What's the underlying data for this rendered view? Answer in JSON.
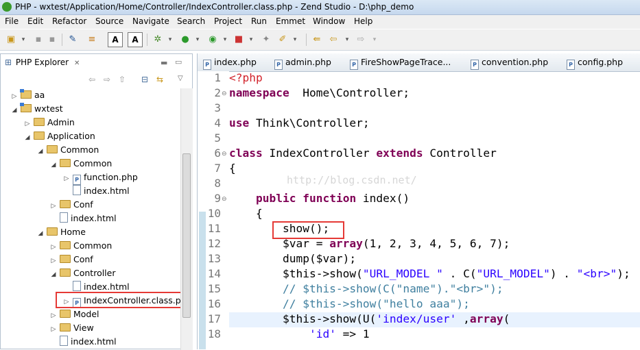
{
  "window": {
    "title": "PHP - wxtest/Application/Home/Controller/IndexController.class.php - Zend Studio - D:\\php_demo"
  },
  "menu": [
    "File",
    "Edit",
    "Refactor",
    "Source",
    "Navigate",
    "Search",
    "Project",
    "Run",
    "Emmet",
    "Window",
    "Help"
  ],
  "explorer": {
    "tab_label": "PHP Explorer",
    "tab_close": "✕",
    "tree": [
      {
        "label": "aa",
        "depth": 0,
        "twisty": "▷",
        "icon": "project"
      },
      {
        "label": "wxtest",
        "depth": 0,
        "twisty": "◢",
        "icon": "project"
      },
      {
        "label": "Admin",
        "depth": 1,
        "twisty": "▷",
        "icon": "folder"
      },
      {
        "label": "Application",
        "depth": 1,
        "twisty": "◢",
        "icon": "folder"
      },
      {
        "label": "Common",
        "depth": 2,
        "twisty": "◢",
        "icon": "folder"
      },
      {
        "label": "Common",
        "depth": 3,
        "twisty": "◢",
        "icon": "folder"
      },
      {
        "label": "function.php",
        "depth": 4,
        "twisty": "▷",
        "icon": "php"
      },
      {
        "label": "index.html",
        "depth": 4,
        "twisty": "",
        "icon": "file"
      },
      {
        "label": "Conf",
        "depth": 3,
        "twisty": "▷",
        "icon": "folder"
      },
      {
        "label": "index.html",
        "depth": 3,
        "twisty": "",
        "icon": "file"
      },
      {
        "label": "Home",
        "depth": 2,
        "twisty": "◢",
        "icon": "folder"
      },
      {
        "label": "Common",
        "depth": 3,
        "twisty": "▷",
        "icon": "folder"
      },
      {
        "label": "Conf",
        "depth": 3,
        "twisty": "▷",
        "icon": "folder"
      },
      {
        "label": "Controller",
        "depth": 3,
        "twisty": "◢",
        "icon": "folder"
      },
      {
        "label": "index.html",
        "depth": 4,
        "twisty": "",
        "icon": "file"
      },
      {
        "label": "IndexController.class.ph",
        "depth": 4,
        "twisty": "▷",
        "icon": "php"
      },
      {
        "label": "Model",
        "depth": 3,
        "twisty": "▷",
        "icon": "folder"
      },
      {
        "label": "View",
        "depth": 3,
        "twisty": "▷",
        "icon": "folder"
      },
      {
        "label": "index.html",
        "depth": 3,
        "twisty": "",
        "icon": "file"
      }
    ]
  },
  "editor": {
    "tabs": [
      "index.php",
      "admin.php",
      "FireShowPageTrace...",
      "convention.php",
      "config.php"
    ],
    "watermark": "http://blog.csdn.net/",
    "line_numbers": [
      "1",
      "2",
      "3",
      "4",
      "5",
      "6",
      "7",
      "8",
      "9",
      "10",
      "11",
      "12",
      "13",
      "14",
      "15",
      "16",
      "17",
      "18"
    ],
    "lines": [
      [
        [
          "tag",
          "<?php"
        ]
      ],
      [
        [
          "kw",
          "namespace"
        ],
        [
          "",
          "  Home\\Controller;"
        ]
      ],
      [],
      [
        [
          "kw",
          "use"
        ],
        [
          "",
          " Think\\Controller;"
        ]
      ],
      [],
      [
        [
          "kw",
          "class"
        ],
        [
          "",
          " IndexController "
        ],
        [
          "kw",
          "extends"
        ],
        [
          "",
          " Controller"
        ]
      ],
      [
        [
          "",
          "{"
        ]
      ],
      [],
      [
        [
          "",
          "    "
        ],
        [
          "kw",
          "public"
        ],
        [
          "",
          " "
        ],
        [
          "kw",
          "function"
        ],
        [
          "",
          " index()"
        ]
      ],
      [
        [
          "",
          "    {"
        ]
      ],
      [
        [
          "",
          "        show();"
        ]
      ],
      [
        [
          "",
          "        $var = "
        ],
        [
          "kw",
          "array"
        ],
        [
          "",
          "(1, 2, 3, 4, 5, 6, 7);"
        ]
      ],
      [
        [
          "",
          "        dump($var);"
        ]
      ],
      [
        [
          "",
          "        $this->show("
        ],
        [
          "str",
          "\"URL_MODEL \""
        ],
        [
          "",
          " . C("
        ],
        [
          "str",
          "\"URL_MODEL\""
        ],
        [
          "",
          ") . "
        ],
        [
          "str",
          "\"<br>\""
        ],
        [
          "",
          ");"
        ]
      ],
      [
        [
          "cm",
          "        // $this->show(C(\"name\").\"<br>\");"
        ]
      ],
      [
        [
          "cm",
          "        // $this->show(\"hello aaa\");"
        ]
      ],
      [
        [
          "",
          "        $this->show(U("
        ],
        [
          "str",
          "'index/user'"
        ],
        [
          "",
          " ,"
        ],
        [
          "kw",
          "array"
        ],
        [
          "",
          "("
        ]
      ],
      [
        [
          "",
          "            "
        ],
        [
          "str",
          "'id'"
        ],
        [
          "",
          " => 1"
        ]
      ]
    ]
  }
}
